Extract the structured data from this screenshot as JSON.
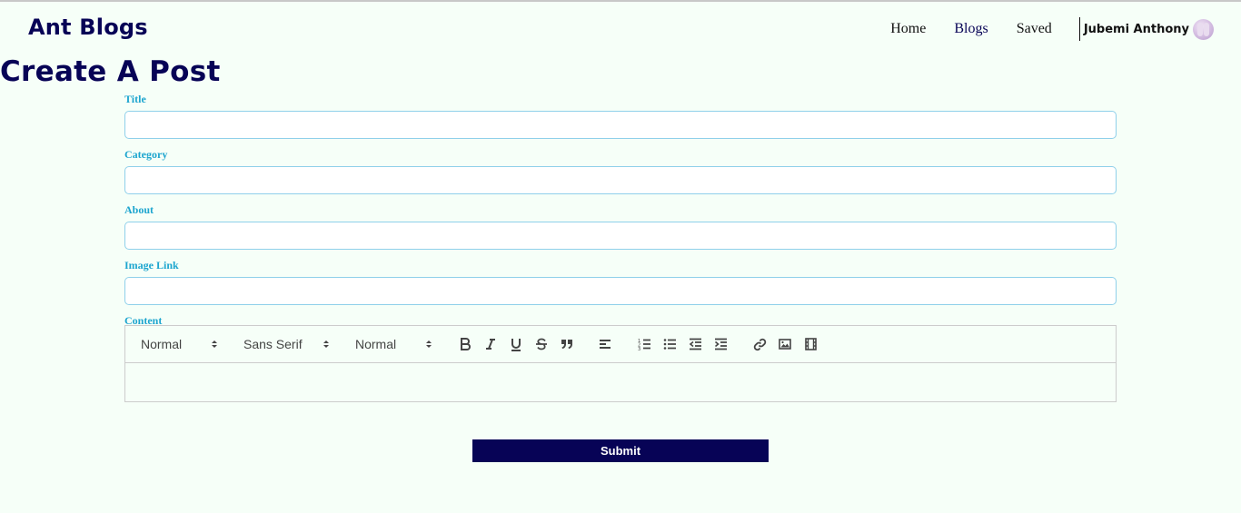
{
  "header": {
    "brand": "Ant Blogs",
    "nav": [
      {
        "label": "Home"
      },
      {
        "label": "Blogs"
      },
      {
        "label": "Saved"
      }
    ],
    "user_name": "Jubemi Anthony"
  },
  "page": {
    "title": "Create A Post"
  },
  "form": {
    "fields": [
      {
        "label": "Title",
        "value": ""
      },
      {
        "label": "Category",
        "value": ""
      },
      {
        "label": "About",
        "value": ""
      },
      {
        "label": "Image Link",
        "value": ""
      }
    ],
    "content_label": "Content",
    "editor": {
      "heading_picker": "Normal",
      "font_picker": "Sans Serif",
      "size_picker": "Normal",
      "buttons": [
        "bold-icon",
        "italic-icon",
        "underline-icon",
        "strikethrough-icon",
        "blockquote-icon",
        "align-left-icon",
        "ordered-list-icon",
        "bullet-list-icon",
        "outdent-icon",
        "indent-icon",
        "link-icon",
        "image-icon",
        "video-icon"
      ]
    },
    "submit_label": "Submit"
  },
  "colors": {
    "brand": "#070356",
    "label": "#1da5cf",
    "background": "#f6fff8",
    "field_border": "#8fd0ea"
  }
}
